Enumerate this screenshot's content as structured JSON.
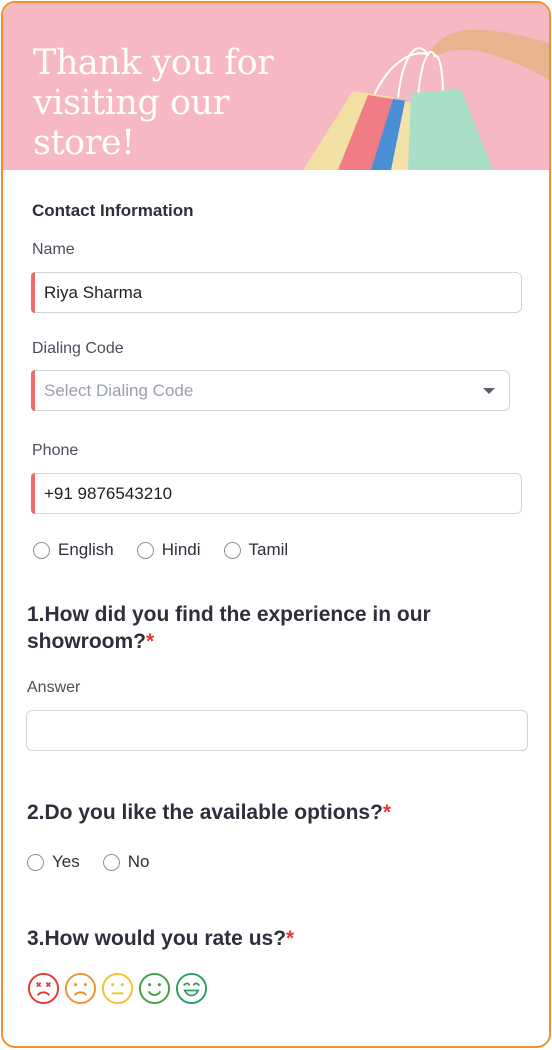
{
  "banner": {
    "title": "Thank you for\nvisiting our store!"
  },
  "contact": {
    "section_title": "Contact Information",
    "name_label": "Name",
    "name_value": "Riya Sharma",
    "dialing_label": "Dialing Code",
    "dialing_placeholder": "Select Dialing Code",
    "phone_label": "Phone",
    "phone_value": "+91 9876543210",
    "languages": [
      "English",
      "Hindi",
      "Tamil"
    ]
  },
  "q1": {
    "text": "1.How did you find the experience in our showroom?",
    "required_mark": "*",
    "answer_label": "Answer",
    "answer_value": ""
  },
  "q2": {
    "text": "2.Do you like the available options?",
    "required_mark": "*",
    "options": [
      "Yes",
      "No"
    ]
  },
  "q3": {
    "text": "3.How would you rate us?",
    "required_mark": "*",
    "ratings": [
      {
        "icon": "very-unhappy-face-icon",
        "color": "#e53935"
      },
      {
        "icon": "unhappy-face-icon",
        "color": "#f0922e"
      },
      {
        "icon": "neutral-face-icon",
        "color": "#f2c230"
      },
      {
        "icon": "happy-face-icon",
        "color": "#43a047"
      },
      {
        "icon": "very-happy-face-icon",
        "color": "#2e9e5b"
      }
    ]
  },
  "colors": {
    "accent_border": "#f0922e",
    "banner_bg": "#f6b9c3",
    "required_bar": "#f06a6a",
    "required_star": "#e53935"
  }
}
